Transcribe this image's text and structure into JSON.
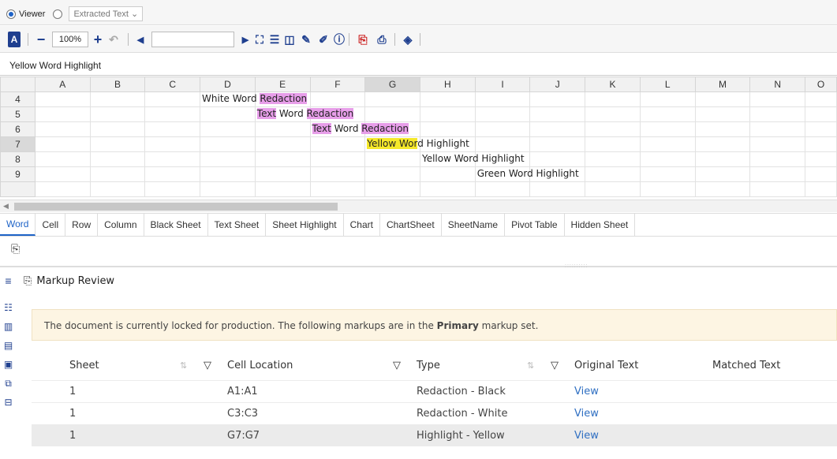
{
  "mode": {
    "viewer_label": "Viewer",
    "extracted_label": "Extracted Text"
  },
  "toolbar": {
    "zoom": "100%",
    "page_input": ""
  },
  "name_box": "Yellow Word Highlight",
  "grid": {
    "columns": [
      "A",
      "B",
      "C",
      "D",
      "E",
      "F",
      "G",
      "H",
      "I",
      "J",
      "K",
      "L",
      "M",
      "N",
      "O"
    ],
    "rows": [
      {
        "num": "4",
        "segments": [
          {
            "col": 3,
            "parts": [
              {
                "text": "White Word ",
                "hl": ""
              },
              {
                "text": "Redaction",
                "hl": "pink"
              }
            ]
          }
        ]
      },
      {
        "num": "5",
        "segments": [
          {
            "col": 4,
            "parts": [
              {
                "text": "Text",
                "hl": "pink"
              },
              {
                "text": " Word ",
                "hl": ""
              },
              {
                "text": "Redaction",
                "hl": "pink"
              }
            ]
          }
        ]
      },
      {
        "num": "6",
        "segments": [
          {
            "col": 5,
            "parts": [
              {
                "text": "Text",
                "hl": "pink"
              },
              {
                "text": " Word ",
                "hl": ""
              },
              {
                "text": "Redaction",
                "hl": "pink"
              }
            ]
          }
        ]
      },
      {
        "num": "7",
        "segments": [
          {
            "col": 6,
            "parts": [
              {
                "text": "Yellow Wor",
                "hl": "yellow"
              },
              {
                "text": "d Highlight",
                "hl": ""
              }
            ]
          }
        ]
      },
      {
        "num": "8",
        "segments": [
          {
            "col": 7,
            "parts": [
              {
                "text": "Yellow Word Highlight",
                "hl": ""
              }
            ]
          }
        ]
      },
      {
        "num": "9",
        "segments": [
          {
            "col": 8,
            "parts": [
              {
                "text": "Green Word Highlight",
                "hl": ""
              }
            ]
          }
        ]
      }
    ],
    "selected_column": "G",
    "selected_row": "7"
  },
  "sheet_tabs": [
    "Word",
    "Cell",
    "Row",
    "Column",
    "Black Sheet",
    "Text Sheet",
    "Sheet Highlight",
    "Chart",
    "ChartSheet",
    "SheetName",
    "Pivot Table",
    "Hidden Sheet"
  ],
  "active_tab": "Word",
  "markup": {
    "title": "Markup Review",
    "banner_pre": "The document is currently locked for production. The following markups are in the ",
    "banner_bold": "Primary",
    "banner_post": " markup set.",
    "headers": {
      "sheet": "Sheet",
      "cell": "Cell Location",
      "type": "Type",
      "orig": "Original Text",
      "matched": "Matched Text"
    },
    "rows": [
      {
        "sheet": "1",
        "cell": "A1:A1",
        "type": "Redaction - Black",
        "orig": "View",
        "matched": ""
      },
      {
        "sheet": "1",
        "cell": "C3:C3",
        "type": "Redaction - White",
        "orig": "View",
        "matched": ""
      },
      {
        "sheet": "1",
        "cell": "G7:G7",
        "type": "Highlight - Yellow",
        "orig": "View",
        "matched": ""
      }
    ]
  },
  "colors": {
    "accent": "#1e63c7",
    "highlight_pink": "#e79ee9",
    "highlight_yellow": "#f5e82a"
  }
}
